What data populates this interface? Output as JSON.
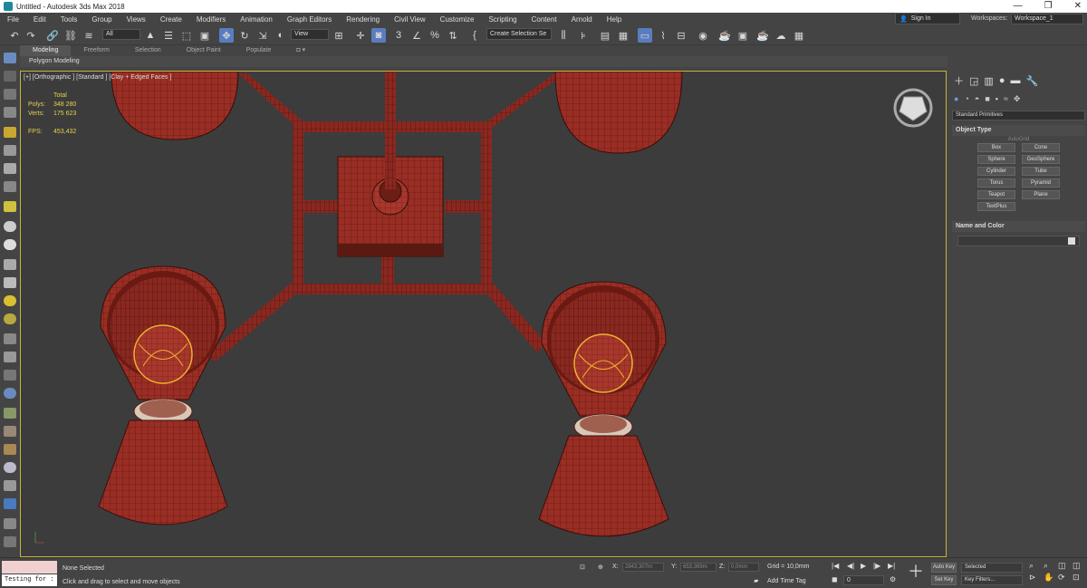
{
  "window": {
    "title": "Untitled - Autodesk 3ds Max 2018",
    "controls": [
      "—",
      "❐",
      "✕"
    ]
  },
  "menu": [
    "File",
    "Edit",
    "Tools",
    "Group",
    "Views",
    "Create",
    "Modifiers",
    "Animation",
    "Graph Editors",
    "Rendering",
    "Civil View",
    "Customize",
    "Scripting",
    "Content",
    "Arnold",
    "Help"
  ],
  "account": {
    "signin": "Sign In",
    "workspaces_label": "Workspaces:",
    "workspace": "Workspace_1"
  },
  "toolbar": {
    "selection_filter": "All",
    "ref_coord": "View",
    "named_selection": "Create Selection Se"
  },
  "ribbon": {
    "tabs": [
      "Modeling",
      "Freeform",
      "Selection",
      "Object Paint",
      "Populate"
    ],
    "active_tab": "Modeling",
    "sub_label": "Polygon Modeling"
  },
  "viewport": {
    "label": "[+] [Orthographic ] [Standard ] [Clay + Edged Faces ]",
    "stats": {
      "total_label": "Total",
      "polys_label": "Polys:",
      "polys": "348 280",
      "verts_label": "Verts:",
      "verts": "175 623",
      "fps_label": "FPS:",
      "fps": "453,432"
    },
    "colors": {
      "mesh_fill": "#9a2e24",
      "mesh_wire": "#3a0e0a",
      "bulb_wire": "#f0b030",
      "background": "#3c3c3c",
      "border": "#c9b43b"
    }
  },
  "command_panel": {
    "category": "Standard Primitives",
    "object_type_title": "Object Type",
    "autogrid": "AutoGrid",
    "objects": [
      "Box",
      "Cone",
      "Sphere",
      "GeoSphere",
      "Cylinder",
      "Tube",
      "Torus",
      "Pyramid",
      "Teapot",
      "Plane",
      "TextPlus"
    ],
    "name_color_title": "Name and Color"
  },
  "status": {
    "maxscript": "Testing for :",
    "selection": "None Selected",
    "prompt": "Click and drag to select and move objects",
    "x_label": "X:",
    "x_value": "2843,307m",
    "y_label": "Y:",
    "y_value": "653,369m",
    "z_label": "Z:",
    "z_value": "0,0mm",
    "grid": "Grid = 10,0mm",
    "add_time_tag": "Add Time Tag",
    "frame": "0",
    "auto_key": "Auto Key",
    "set_key": "Set Key",
    "key_mode": "Selected",
    "key_filters": "Key Filters..."
  }
}
